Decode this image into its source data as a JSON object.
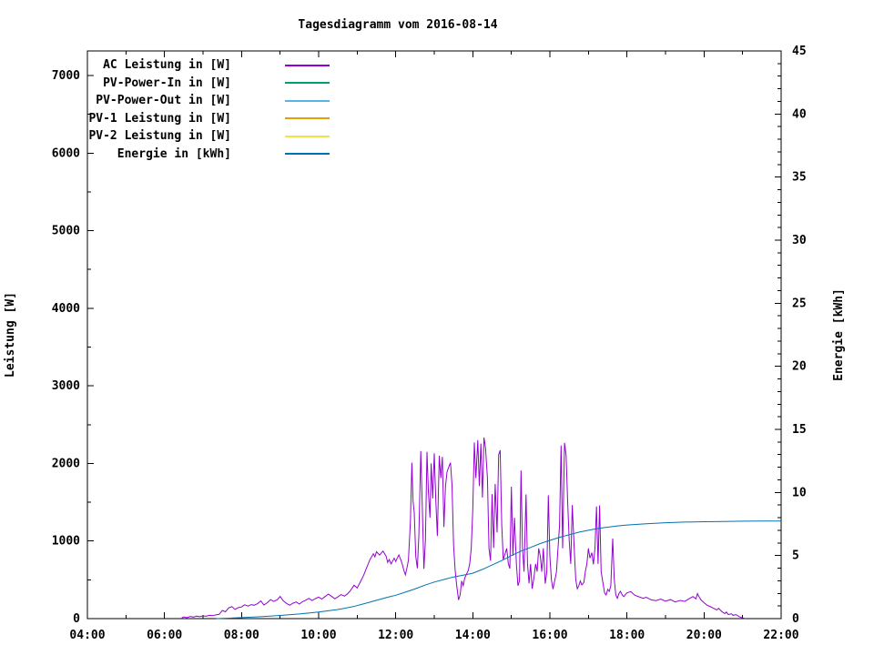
{
  "chart_data": {
    "type": "line",
    "title": "Tagesdiagramm vom 2016-08-14",
    "background_color": "#ffffff",
    "border_color": "#000000",
    "grid": false,
    "legend_position": "top-left-inside",
    "x_axis": {
      "range_hours": [
        4,
        22
      ],
      "major_tick_every_hours": 2,
      "minor_tick_every_hours": 1,
      "tick_labels": [
        "04:00",
        "06:00",
        "08:00",
        "10:00",
        "12:00",
        "14:00",
        "16:00",
        "18:00",
        "20:00",
        "22:00"
      ]
    },
    "y_left": {
      "label": "Leistung [W]",
      "range": [
        0,
        7000
      ],
      "major_tick_step": 1000,
      "minor_tick_step": 500,
      "tick_labels": [
        "0",
        "1000",
        "2000",
        "3000",
        "4000",
        "5000",
        "6000",
        "7000"
      ]
    },
    "y_right": {
      "label": "Energie [kWh]",
      "range": [
        0,
        45
      ],
      "major_tick_step": 5,
      "minor_tick_step": 1,
      "tick_labels": [
        "0",
        "5",
        "10",
        "15",
        "20",
        "25",
        "30",
        "35",
        "40",
        "45"
      ]
    },
    "legend": {
      "entries": [
        {
          "label": "AC Leistung in [W]",
          "color": "#9400d3"
        },
        {
          "label": "PV-Power-In in [W]",
          "color": "#009e73"
        },
        {
          "label": "PV-Power-Out in [W]",
          "color": "#56b4e9"
        },
        {
          "label": "PV-1 Leistung in [W]",
          "color": "#e69f00"
        },
        {
          "label": "PV-2 Leistung in [W]",
          "color": "#f0e442"
        },
        {
          "label": "Energie in [kWh]",
          "color": "#0072b2"
        }
      ]
    },
    "series": [
      {
        "name": "AC Leistung in [W]",
        "color": "#9400d3",
        "yaxis": "left",
        "points": [
          [
            6.45,
            8
          ],
          [
            6.5,
            22
          ],
          [
            6.58,
            12
          ],
          [
            6.67,
            28
          ],
          [
            6.75,
            20
          ],
          [
            6.83,
            32
          ],
          [
            6.92,
            25
          ],
          [
            7.0,
            35
          ],
          [
            7.08,
            30
          ],
          [
            7.17,
            42
          ],
          [
            7.25,
            38
          ],
          [
            7.33,
            48
          ],
          [
            7.42,
            55
          ],
          [
            7.5,
            105
          ],
          [
            7.58,
            88
          ],
          [
            7.67,
            140
          ],
          [
            7.75,
            155
          ],
          [
            7.83,
            118
          ],
          [
            7.92,
            142
          ],
          [
            8.0,
            150
          ],
          [
            8.08,
            178
          ],
          [
            8.17,
            162
          ],
          [
            8.25,
            180
          ],
          [
            8.33,
            172
          ],
          [
            8.42,
            195
          ],
          [
            8.5,
            228
          ],
          [
            8.58,
            175
          ],
          [
            8.67,
            205
          ],
          [
            8.75,
            245
          ],
          [
            8.83,
            222
          ],
          [
            8.92,
            240
          ],
          [
            9.0,
            285
          ],
          [
            9.08,
            230
          ],
          [
            9.17,
            195
          ],
          [
            9.25,
            172
          ],
          [
            9.33,
            198
          ],
          [
            9.42,
            215
          ],
          [
            9.5,
            188
          ],
          [
            9.58,
            218
          ],
          [
            9.67,
            238
          ],
          [
            9.75,
            262
          ],
          [
            9.83,
            232
          ],
          [
            9.92,
            258
          ],
          [
            10.0,
            278
          ],
          [
            10.08,
            252
          ],
          [
            10.17,
            285
          ],
          [
            10.25,
            315
          ],
          [
            10.33,
            290
          ],
          [
            10.42,
            255
          ],
          [
            10.5,
            280
          ],
          [
            10.58,
            310
          ],
          [
            10.67,
            290
          ],
          [
            10.75,
            320
          ],
          [
            10.83,
            365
          ],
          [
            10.92,
            430
          ],
          [
            11.0,
            395
          ],
          [
            11.08,
            470
          ],
          [
            11.17,
            560
          ],
          [
            11.25,
            660
          ],
          [
            11.33,
            760
          ],
          [
            11.42,
            835
          ],
          [
            11.46,
            795
          ],
          [
            11.5,
            862
          ],
          [
            11.58,
            820
          ],
          [
            11.67,
            870
          ],
          [
            11.75,
            805
          ],
          [
            11.79,
            725
          ],
          [
            11.83,
            762
          ],
          [
            11.88,
            705
          ],
          [
            11.92,
            742
          ],
          [
            11.96,
            778
          ],
          [
            12.0,
            735
          ],
          [
            12.04,
            782
          ],
          [
            12.08,
            820
          ],
          [
            12.13,
            760
          ],
          [
            12.17,
            700
          ],
          [
            12.21,
            622
          ],
          [
            12.25,
            565
          ],
          [
            12.29,
            648
          ],
          [
            12.33,
            750
          ],
          [
            12.38,
            1250
          ],
          [
            12.42,
            2010
          ],
          [
            12.45,
            1510
          ],
          [
            12.48,
            1370
          ],
          [
            12.52,
            800
          ],
          [
            12.56,
            648
          ],
          [
            12.6,
            1080
          ],
          [
            12.65,
            2160
          ],
          [
            12.69,
            1420
          ],
          [
            12.73,
            640
          ],
          [
            12.77,
            1010
          ],
          [
            12.81,
            2150
          ],
          [
            12.85,
            1620
          ],
          [
            12.89,
            1300
          ],
          [
            12.92,
            2000
          ],
          [
            12.96,
            1550
          ],
          [
            13.0,
            2130
          ],
          [
            13.04,
            1520
          ],
          [
            13.08,
            1065
          ],
          [
            13.13,
            2100
          ],
          [
            13.17,
            1810
          ],
          [
            13.21,
            2085
          ],
          [
            13.25,
            1180
          ],
          [
            13.29,
            1700
          ],
          [
            13.33,
            1890
          ],
          [
            13.38,
            1960
          ],
          [
            13.42,
            2010
          ],
          [
            13.46,
            1720
          ],
          [
            13.5,
            950
          ],
          [
            13.54,
            630
          ],
          [
            13.58,
            430
          ],
          [
            13.63,
            240
          ],
          [
            13.67,
            305
          ],
          [
            13.71,
            485
          ],
          [
            13.75,
            425
          ],
          [
            13.79,
            520
          ],
          [
            13.83,
            565
          ],
          [
            13.88,
            620
          ],
          [
            13.92,
            705
          ],
          [
            13.96,
            905
          ],
          [
            14.0,
            1400
          ],
          [
            14.04,
            2270
          ],
          [
            14.08,
            1810
          ],
          [
            14.13,
            2300
          ],
          [
            14.17,
            1710
          ],
          [
            14.21,
            2255
          ],
          [
            14.25,
            1560
          ],
          [
            14.29,
            2335
          ],
          [
            14.33,
            2200
          ],
          [
            14.38,
            1810
          ],
          [
            14.42,
            905
          ],
          [
            14.46,
            745
          ],
          [
            14.5,
            1605
          ],
          [
            14.54,
            910
          ],
          [
            14.58,
            1735
          ],
          [
            14.63,
            1110
          ],
          [
            14.67,
            2110
          ],
          [
            14.71,
            2170
          ],
          [
            14.75,
            1210
          ],
          [
            14.79,
            760
          ],
          [
            14.83,
            825
          ],
          [
            14.88,
            905
          ],
          [
            14.92,
            710
          ],
          [
            14.96,
            645
          ],
          [
            15.0,
            1700
          ],
          [
            15.04,
            810
          ],
          [
            15.08,
            1300
          ],
          [
            15.13,
            705
          ],
          [
            15.17,
            425
          ],
          [
            15.21,
            485
          ],
          [
            15.25,
            1910
          ],
          [
            15.29,
            910
          ],
          [
            15.33,
            605
          ],
          [
            15.38,
            1600
          ],
          [
            15.42,
            705
          ],
          [
            15.46,
            455
          ],
          [
            15.5,
            705
          ],
          [
            15.54,
            385
          ],
          [
            15.58,
            505
          ],
          [
            15.63,
            705
          ],
          [
            15.67,
            605
          ],
          [
            15.71,
            905
          ],
          [
            15.75,
            810
          ],
          [
            15.79,
            605
          ],
          [
            15.83,
            905
          ],
          [
            15.88,
            450
          ],
          [
            15.92,
            600
          ],
          [
            15.96,
            1590
          ],
          [
            16.0,
            800
          ],
          [
            16.04,
            500
          ],
          [
            16.08,
            380
          ],
          [
            16.13,
            500
          ],
          [
            16.17,
            600
          ],
          [
            16.21,
            905
          ],
          [
            16.25,
            1200
          ],
          [
            16.29,
            2230
          ],
          [
            16.33,
            905
          ],
          [
            16.38,
            2265
          ],
          [
            16.42,
            2105
          ],
          [
            16.46,
            1510
          ],
          [
            16.5,
            1010
          ],
          [
            16.54,
            705
          ],
          [
            16.58,
            1465
          ],
          [
            16.63,
            905
          ],
          [
            16.67,
            505
          ],
          [
            16.71,
            385
          ],
          [
            16.75,
            425
          ],
          [
            16.79,
            485
          ],
          [
            16.83,
            435
          ],
          [
            16.88,
            465
          ],
          [
            16.92,
            605
          ],
          [
            16.96,
            705
          ],
          [
            17.0,
            905
          ],
          [
            17.04,
            780
          ],
          [
            17.09,
            850
          ],
          [
            17.13,
            700
          ],
          [
            17.17,
            905
          ],
          [
            17.21,
            1445
          ],
          [
            17.25,
            705
          ],
          [
            17.29,
            1460
          ],
          [
            17.33,
            605
          ],
          [
            17.38,
            450
          ],
          [
            17.42,
            330
          ],
          [
            17.46,
            305
          ],
          [
            17.5,
            378
          ],
          [
            17.54,
            352
          ],
          [
            17.58,
            420
          ],
          [
            17.63,
            1032
          ],
          [
            17.67,
            505
          ],
          [
            17.71,
            305
          ],
          [
            17.75,
            262
          ],
          [
            17.79,
            322
          ],
          [
            17.83,
            352
          ],
          [
            17.88,
            302
          ],
          [
            17.92,
            282
          ],
          [
            17.96,
            312
          ],
          [
            18.0,
            332
          ],
          [
            18.1,
            348
          ],
          [
            18.2,
            302
          ],
          [
            18.3,
            282
          ],
          [
            18.42,
            262
          ],
          [
            18.5,
            275
          ],
          [
            18.63,
            242
          ],
          [
            18.75,
            232
          ],
          [
            18.88,
            252
          ],
          [
            19.0,
            225
          ],
          [
            19.13,
            245
          ],
          [
            19.25,
            215
          ],
          [
            19.38,
            235
          ],
          [
            19.5,
            222
          ],
          [
            19.63,
            262
          ],
          [
            19.71,
            285
          ],
          [
            19.79,
            255
          ],
          [
            19.83,
            322
          ],
          [
            19.88,
            272
          ],
          [
            19.92,
            242
          ],
          [
            20.0,
            205
          ],
          [
            20.08,
            172
          ],
          [
            20.17,
            152
          ],
          [
            20.25,
            132
          ],
          [
            20.33,
            112
          ],
          [
            20.38,
            132
          ],
          [
            20.46,
            92
          ],
          [
            20.54,
            65
          ],
          [
            20.58,
            85
          ],
          [
            20.63,
            52
          ],
          [
            20.71,
            62
          ],
          [
            20.75,
            42
          ],
          [
            20.83,
            52
          ],
          [
            20.92,
            22
          ],
          [
            21.0,
            8
          ],
          [
            21.08,
            0
          ]
        ]
      },
      {
        "name": "Energie in [kWh]",
        "color": "#0072b2",
        "yaxis": "right",
        "points": [
          [
            7.35,
            0
          ],
          [
            7.6,
            0.03
          ],
          [
            8.0,
            0.08
          ],
          [
            8.5,
            0.15
          ],
          [
            9.0,
            0.25
          ],
          [
            9.5,
            0.37
          ],
          [
            10.0,
            0.52
          ],
          [
            10.5,
            0.72
          ],
          [
            10.9,
            0.95
          ],
          [
            11.2,
            1.2
          ],
          [
            11.5,
            1.45
          ],
          [
            11.8,
            1.7
          ],
          [
            12.0,
            1.85
          ],
          [
            12.25,
            2.1
          ],
          [
            12.5,
            2.35
          ],
          [
            12.75,
            2.65
          ],
          [
            13.0,
            2.9
          ],
          [
            13.25,
            3.1
          ],
          [
            13.5,
            3.3
          ],
          [
            13.75,
            3.45
          ],
          [
            14.0,
            3.6
          ],
          [
            14.25,
            3.9
          ],
          [
            14.5,
            4.25
          ],
          [
            14.75,
            4.6
          ],
          [
            15.0,
            5.0
          ],
          [
            15.25,
            5.35
          ],
          [
            15.5,
            5.65
          ],
          [
            15.75,
            5.95
          ],
          [
            16.0,
            6.2
          ],
          [
            16.25,
            6.45
          ],
          [
            16.5,
            6.65
          ],
          [
            16.75,
            6.85
          ],
          [
            17.0,
            7.0
          ],
          [
            17.25,
            7.15
          ],
          [
            17.5,
            7.25
          ],
          [
            17.75,
            7.35
          ],
          [
            18.0,
            7.42
          ],
          [
            18.5,
            7.52
          ],
          [
            19.0,
            7.6
          ],
          [
            19.5,
            7.65
          ],
          [
            20.0,
            7.68
          ],
          [
            20.5,
            7.7
          ],
          [
            21.0,
            7.72
          ],
          [
            21.5,
            7.73
          ],
          [
            22.0,
            7.73
          ]
        ]
      }
    ]
  }
}
